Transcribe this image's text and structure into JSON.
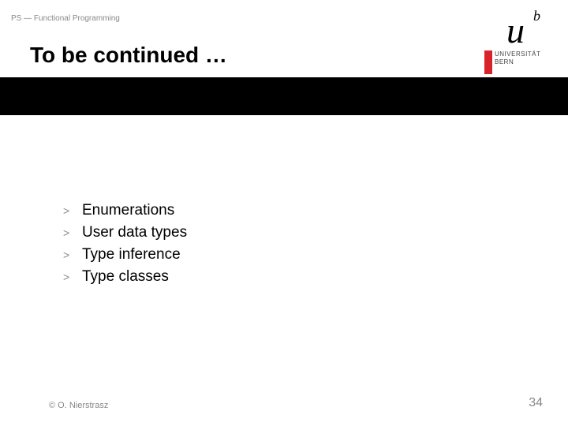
{
  "breadcrumb": "PS — Functional Programming",
  "title": "To be continued …",
  "logo": {
    "u": "u",
    "b": "b",
    "line1": "UNIVERSITÄT",
    "line2": "BERN"
  },
  "items": [
    {
      "marker": ">",
      "text": "Enumerations"
    },
    {
      "marker": ">",
      "text": "User data types"
    },
    {
      "marker": ">",
      "text": "Type inference"
    },
    {
      "marker": ">",
      "text": "Type classes"
    }
  ],
  "footer": {
    "copyright": "© O. Nierstrasz",
    "page": "34"
  }
}
